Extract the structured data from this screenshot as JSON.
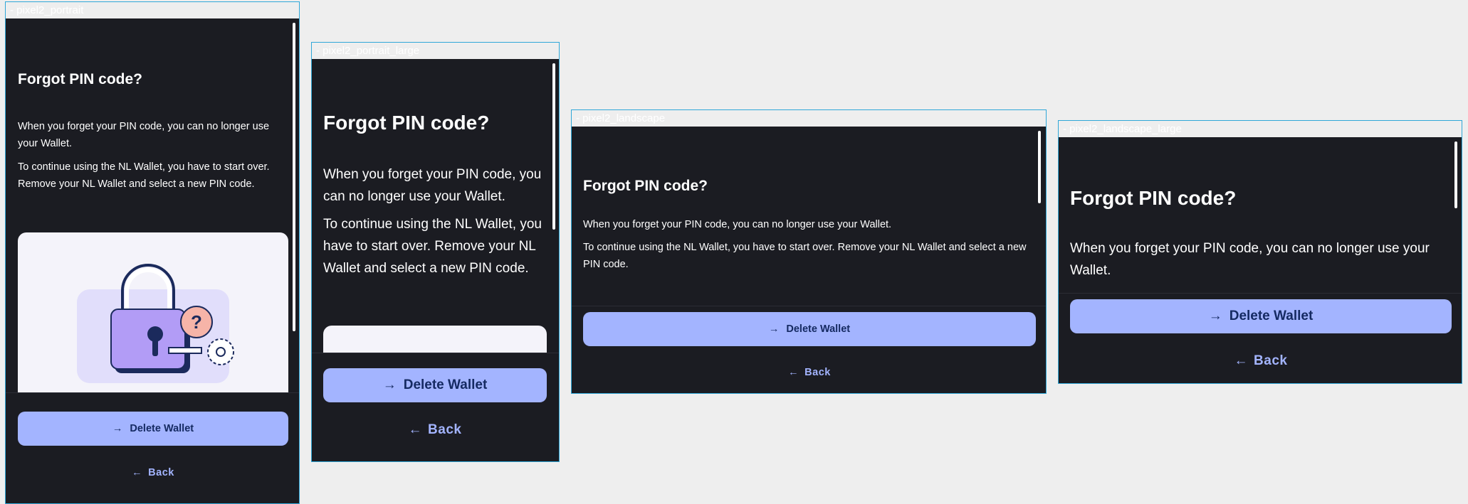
{
  "frames": [
    {
      "label": "- pixel2_portrait"
    },
    {
      "label": "- pixel2_portrait_large"
    },
    {
      "label": "- pixel2_landscape"
    },
    {
      "label": "- pixel2_landscape_large"
    }
  ],
  "screen": {
    "title": "Forgot PIN code?",
    "paragraph1": "When you forget your PIN code, you can no longer use your Wallet.",
    "paragraph2": "To continue using the NL Wallet, you have to start over. Remove your NL Wallet and select a new PIN code.",
    "delete_button": "Delete Wallet",
    "back_button": "Back"
  },
  "icons": {
    "delete": "arrow-right-icon",
    "back": "arrow-left-icon"
  },
  "colors": {
    "background": "#1b1c22",
    "primary_button": "#a3b4ff",
    "primary_button_text": "#152a62",
    "link_text": "#a3b4ff",
    "frame_border": "#2fa7d8"
  }
}
